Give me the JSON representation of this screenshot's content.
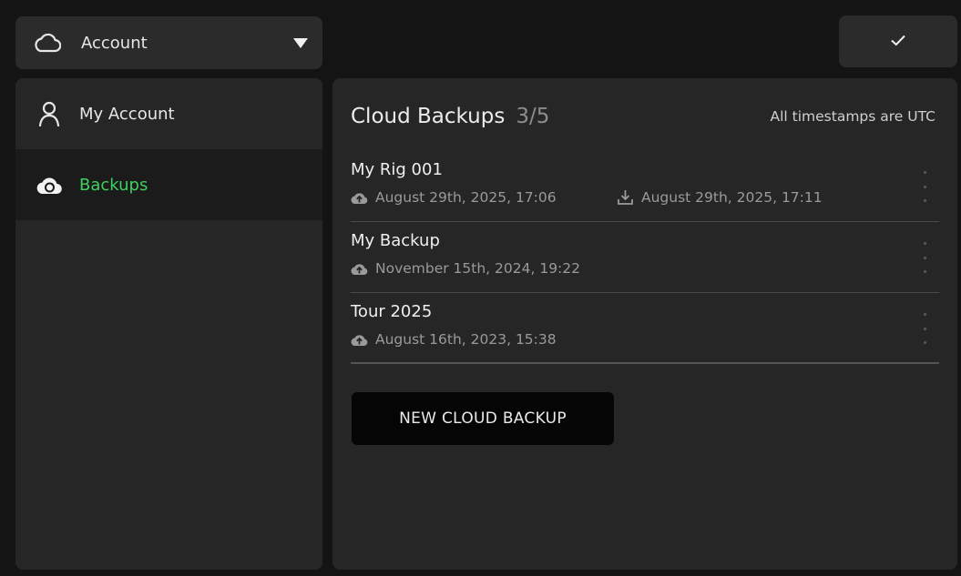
{
  "topbar": {
    "dropdown_label": "Account",
    "dropdown_icon": "cloud-outline-icon",
    "caret_icon": "caret-down-icon",
    "confirm_icon": "checkmark-icon"
  },
  "sidebar": {
    "items": [
      {
        "label": "My Account",
        "icon": "person-icon",
        "active": false
      },
      {
        "label": "Backups",
        "icon": "cloud-sync-icon",
        "active": true
      }
    ]
  },
  "panel": {
    "title": "Cloud Backups",
    "count": "3/5",
    "note": "All timestamps are UTC",
    "backups": [
      {
        "name": "My Rig 001",
        "uploaded": "August 29th, 2025, 17:06",
        "downloaded": "August 29th, 2025, 17:11"
      },
      {
        "name": "My Backup",
        "uploaded": "November 15th, 2024, 19:22",
        "downloaded": ""
      },
      {
        "name": "Tour 2025",
        "uploaded": "August 16th, 2023, 15:38",
        "downloaded": ""
      }
    ],
    "new_button_label": "NEW CLOUD BACKUP"
  },
  "colors": {
    "background": "#141414",
    "panel": "#262626",
    "active_text": "#3fd05f",
    "muted_text": "#9a9a9a",
    "button_dark": "#050505"
  }
}
